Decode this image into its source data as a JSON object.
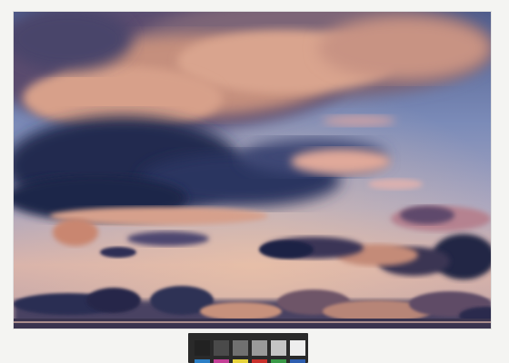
{
  "scene": {
    "subject": "sunset-sky-with-clouds",
    "colors": {
      "sky_top": "#5b6a98",
      "sky_mid": "#8797c0",
      "sky_low": "#c9a8a8",
      "horizon_glow": "#f1c7a6",
      "cloud_lit": "#d9a58d",
      "cloud_peach": "#e8b39a",
      "cloud_dark": "#2b2f57",
      "cloud_deep": "#1d2148",
      "page_border": "#f4f4f2"
    }
  },
  "calibration_card": {
    "gray_row": [
      "#222222",
      "#4a4a4a",
      "#707070",
      "#9a9a9a",
      "#c4c4c4",
      "#eeeeee"
    ],
    "color_row": [
      "#2b7fc6",
      "#c43f96",
      "#e6d23a",
      "#c9302c",
      "#3a9a48",
      "#2e5fb0"
    ]
  }
}
